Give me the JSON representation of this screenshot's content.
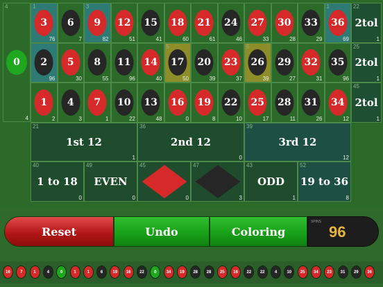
{
  "zero": {
    "number": "0",
    "count": "4",
    "top_label": "4",
    "color": "green"
  },
  "grid": [
    [
      {
        "n": "3",
        "c": "red",
        "tl": "1",
        "br": "76",
        "hl": true
      },
      {
        "n": "6",
        "c": "black",
        "tl": "",
        "br": "7",
        "hl": false
      },
      {
        "n": "9",
        "c": "red",
        "tl": "3",
        "br": "82",
        "hl": true
      },
      {
        "n": "12",
        "c": "red",
        "tl": "",
        "br": "51",
        "hl": false
      },
      {
        "n": "15",
        "c": "black",
        "tl": "",
        "br": "41",
        "hl": false
      },
      {
        "n": "18",
        "c": "red",
        "tl": "",
        "br": "60",
        "hl": false
      },
      {
        "n": "21",
        "c": "red",
        "tl": "",
        "br": "61",
        "hl": false
      },
      {
        "n": "24",
        "c": "black",
        "tl": "",
        "br": "46",
        "hl": false
      },
      {
        "n": "27",
        "c": "red",
        "tl": "",
        "br": "33",
        "hl": false
      },
      {
        "n": "30",
        "c": "red",
        "tl": "",
        "br": "28",
        "hl": false
      },
      {
        "n": "33",
        "c": "black",
        "tl": "",
        "br": "29",
        "hl": false
      },
      {
        "n": "36",
        "c": "red",
        "tl": "1",
        "br": "69",
        "hl": true
      }
    ],
    [
      {
        "n": "2",
        "c": "black",
        "tl": "",
        "br": "96",
        "hl": true
      },
      {
        "n": "5",
        "c": "red",
        "tl": "",
        "br": "30",
        "hl": false
      },
      {
        "n": "8",
        "c": "black",
        "tl": "",
        "br": "55",
        "hl": false
      },
      {
        "n": "11",
        "c": "black",
        "tl": "",
        "br": "96",
        "hl": false
      },
      {
        "n": "14",
        "c": "red",
        "tl": "",
        "br": "40",
        "hl": false
      },
      {
        "n": "17",
        "c": "black",
        "tl": "5",
        "br": "50",
        "hl": "gold"
      },
      {
        "n": "20",
        "c": "black",
        "tl": "",
        "br": "39",
        "hl": false
      },
      {
        "n": "23",
        "c": "red",
        "tl": "",
        "br": "37",
        "hl": false
      },
      {
        "n": "26",
        "c": "black",
        "tl": "5",
        "br": "39",
        "hl": "gold"
      },
      {
        "n": "29",
        "c": "black",
        "tl": "",
        "br": "27",
        "hl": false
      },
      {
        "n": "32",
        "c": "red",
        "tl": "",
        "br": "31",
        "hl": false
      },
      {
        "n": "35",
        "c": "black",
        "tl": "",
        "br": "96",
        "hl": false
      }
    ],
    [
      {
        "n": "1",
        "c": "red",
        "tl": "",
        "br": "2",
        "hl": false
      },
      {
        "n": "4",
        "c": "black",
        "tl": "",
        "br": "3",
        "hl": false
      },
      {
        "n": "7",
        "c": "red",
        "tl": "",
        "br": "1",
        "hl": false
      },
      {
        "n": "10",
        "c": "black",
        "tl": "",
        "br": "22",
        "hl": false
      },
      {
        "n": "13",
        "c": "black",
        "tl": "",
        "br": "48",
        "hl": false
      },
      {
        "n": "16",
        "c": "red",
        "tl": "",
        "br": "0",
        "hl": false
      },
      {
        "n": "19",
        "c": "red",
        "tl": "",
        "br": "8",
        "hl": false
      },
      {
        "n": "22",
        "c": "black",
        "tl": "",
        "br": "10",
        "hl": false
      },
      {
        "n": "25",
        "c": "red",
        "tl": "",
        "br": "17",
        "hl": false
      },
      {
        "n": "28",
        "c": "black",
        "tl": "",
        "br": "11",
        "hl": false
      },
      {
        "n": "31",
        "c": "black",
        "tl": "",
        "br": "26",
        "hl": false
      },
      {
        "n": "34",
        "c": "red",
        "tl": "",
        "br": "12",
        "hl": false
      }
    ]
  ],
  "columns": [
    {
      "label": "2tol",
      "tl": "22",
      "br": "1"
    },
    {
      "label": "2tol",
      "tl": "25",
      "br": "1"
    },
    {
      "label": "2tol",
      "tl": "45",
      "br": "1"
    }
  ],
  "dozens": [
    {
      "label": "1st 12",
      "tl": "21",
      "br": "1"
    },
    {
      "label": "2nd 12",
      "tl": "36",
      "br": "0"
    },
    {
      "label": "3rd 12",
      "tl": "39",
      "br": "12"
    }
  ],
  "outside": [
    {
      "label": "1 to 18",
      "tl": "40",
      "br": "0",
      "kind": "text"
    },
    {
      "label": "EVEN",
      "tl": "49",
      "br": "0",
      "kind": "text"
    },
    {
      "label": "",
      "tl": "45",
      "br": "0",
      "kind": "red-diamond"
    },
    {
      "label": "",
      "tl": "47",
      "br": "3",
      "kind": "black-diamond"
    },
    {
      "label": "ODD",
      "tl": "43",
      "br": "1",
      "kind": "text"
    },
    {
      "label": "19 to 36",
      "tl": "52",
      "br": "8",
      "kind": "text"
    }
  ],
  "controls": {
    "reset": "Reset",
    "undo": "Undo",
    "coloring": "Coloring",
    "spins_label": "SPINS",
    "spins_count": "96"
  },
  "history": [
    {
      "n": "16",
      "c": "red"
    },
    {
      "n": "7",
      "c": "red"
    },
    {
      "n": "1",
      "c": "red"
    },
    {
      "n": "4",
      "c": "black"
    },
    {
      "n": "0",
      "c": "green"
    },
    {
      "n": "1",
      "c": "red"
    },
    {
      "n": "1",
      "c": "red"
    },
    {
      "n": "6",
      "c": "black"
    },
    {
      "n": "19",
      "c": "red"
    },
    {
      "n": "16",
      "c": "red"
    },
    {
      "n": "22",
      "c": "black"
    },
    {
      "n": "0",
      "c": "green"
    },
    {
      "n": "34",
      "c": "red"
    },
    {
      "n": "19",
      "c": "red"
    },
    {
      "n": "28",
      "c": "black"
    },
    {
      "n": "28",
      "c": "black"
    },
    {
      "n": "25",
      "c": "red"
    },
    {
      "n": "16",
      "c": "red"
    },
    {
      "n": "22",
      "c": "black"
    },
    {
      "n": "22",
      "c": "black"
    },
    {
      "n": "4",
      "c": "black"
    },
    {
      "n": "10",
      "c": "black"
    },
    {
      "n": "25",
      "c": "red"
    },
    {
      "n": "34",
      "c": "red"
    },
    {
      "n": "23",
      "c": "red"
    },
    {
      "n": "31",
      "c": "black"
    },
    {
      "n": "29",
      "c": "black"
    },
    {
      "n": "36",
      "c": "red"
    }
  ],
  "colors": {
    "felt": "#2c6a2a",
    "red": "#d62a2a",
    "black": "#262626",
    "green": "#1fa81f",
    "highlight": "#2e7a74",
    "gold": "#8d8d2a",
    "spins_number": "#e9b43a"
  }
}
